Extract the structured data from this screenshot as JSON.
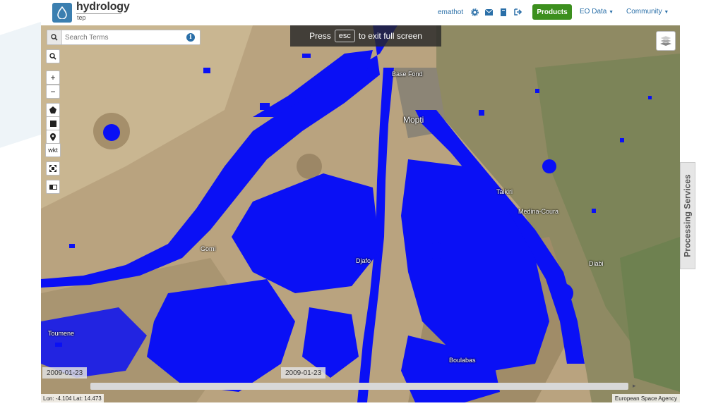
{
  "header": {
    "app_title": "hydrology",
    "app_subtitle": "tep",
    "username": "emathot",
    "products_label": "Products",
    "eo_data_label": "EO Data",
    "community_label": "Community",
    "icons": [
      "settings-icon",
      "mail-icon",
      "book-icon",
      "logout-icon"
    ]
  },
  "banner": {
    "press": "Press",
    "key": "esc",
    "rest": "to exit full screen"
  },
  "search": {
    "placeholder": "Search Terms",
    "value": ""
  },
  "tools": {
    "wkt_label": "wkt"
  },
  "map": {
    "labels": {
      "base_fond": "Base Fond",
      "mopti": "Mopti",
      "taikiri": "Taikiri",
      "medina_coura": "Medina-Coura",
      "diabi": "Diabi",
      "gomi": "Gomi",
      "djafo": "Djafo",
      "toumene": "Toumene",
      "boulabas": "Boulabas"
    },
    "water_color": "#0a10f5"
  },
  "side_tab": {
    "label": "Processing Services"
  },
  "timeline": {
    "start_date": "2009-01-23",
    "current_date": "2009-01-23"
  },
  "status": {
    "coords": "Lon: -4.104 Lat: 14.473",
    "attribution": "European Space Agency"
  }
}
